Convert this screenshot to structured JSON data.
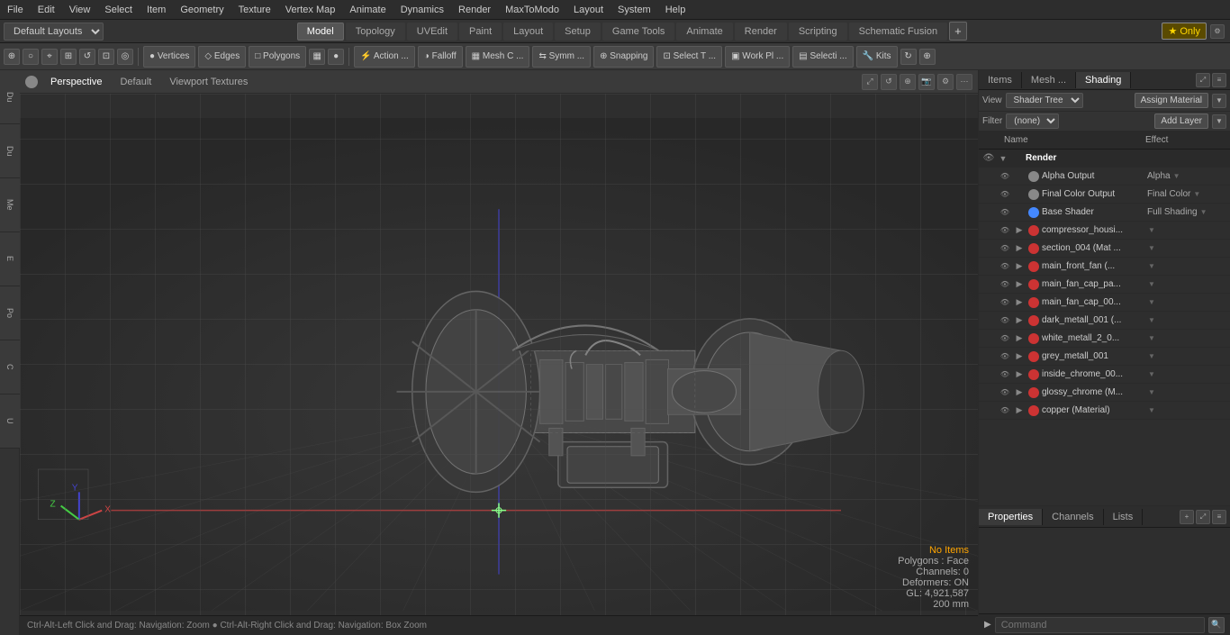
{
  "menubar": {
    "items": [
      "File",
      "Edit",
      "View",
      "Select",
      "Item",
      "Geometry",
      "Texture",
      "Vertex Map",
      "Animate",
      "Dynamics",
      "Render",
      "MaxToModo",
      "Layout",
      "System",
      "Help"
    ]
  },
  "layout_bar": {
    "dropdown": "Default Layouts",
    "tabs": [
      "Model",
      "Topology",
      "UVEdit",
      "Paint",
      "Layout",
      "Setup",
      "Game Tools",
      "Animate",
      "Render",
      "Scripting",
      "Schematic Fusion"
    ],
    "active_tab": "Model",
    "star_label": "★ Only",
    "plus_label": "+"
  },
  "toolbar": {
    "buttons": [
      {
        "label": "Vertices",
        "icon": "●"
      },
      {
        "label": "Edges",
        "icon": "◇"
      },
      {
        "label": "Polygons",
        "icon": "□"
      },
      {
        "label": "Action ...",
        "icon": "⚡"
      },
      {
        "label": "Falloff",
        "icon": "◑"
      },
      {
        "label": "Mesh C ...",
        "icon": "▦"
      },
      {
        "label": "Symm ...",
        "icon": "⇆"
      },
      {
        "label": "Snapping",
        "icon": "⊕"
      },
      {
        "label": "Select T ...",
        "icon": "⊡"
      },
      {
        "label": "Work Pl ...",
        "icon": "▣"
      },
      {
        "label": "Selecti ...",
        "icon": "▤"
      },
      {
        "label": "Kits",
        "icon": "🔧"
      }
    ]
  },
  "left_sidebar": {
    "tabs": [
      "Du",
      "Du",
      "Me",
      "E",
      "Po",
      "C",
      "U"
    ]
  },
  "viewport": {
    "header": {
      "dot_label": "●",
      "perspective": "Perspective",
      "default": "Default",
      "viewport_textures": "Viewport Textures"
    },
    "info": {
      "no_items": "No Items",
      "polygons": "Polygons : Face",
      "channels": "Channels: 0",
      "deformers": "Deformers: ON",
      "gl": "GL: 4,921,587",
      "size": "200 mm"
    },
    "status_bar": "Ctrl-Alt-Left Click and Drag: Navigation: Zoom  ●  Ctrl-Alt-Right Click and Drag: Navigation: Box Zoom"
  },
  "right_panel": {
    "top_tabs": [
      "Items",
      "Mesh ...",
      "Shading"
    ],
    "active_top_tab": "Shading",
    "view_label": "View",
    "view_options": [
      "Shader Tree"
    ],
    "assign_material": "Assign Material",
    "filter_label": "Filter",
    "filter_options": [
      "(none)"
    ],
    "add_layer": "Add Layer",
    "columns": {
      "name": "Name",
      "effect": "Effect"
    },
    "shader_items": [
      {
        "type": "render",
        "name": "Render",
        "effect": "",
        "indent": 0,
        "has_expand": true,
        "color": null
      },
      {
        "type": "item",
        "name": "Alpha Output",
        "effect": "Alpha",
        "indent": 1,
        "has_expand": false,
        "color": "#888"
      },
      {
        "type": "item",
        "name": "Final Color Output",
        "effect": "Final Color",
        "indent": 1,
        "has_expand": false,
        "color": "#888"
      },
      {
        "type": "item",
        "name": "Base Shader",
        "effect": "Full Shading",
        "indent": 1,
        "has_expand": false,
        "color": "#4488ff"
      },
      {
        "type": "item",
        "name": "compressor_housi...",
        "effect": "",
        "indent": 1,
        "has_expand": true,
        "color": "#cc3333"
      },
      {
        "type": "item",
        "name": "section_004 (Mat ...",
        "effect": "",
        "indent": 1,
        "has_expand": true,
        "color": "#cc3333"
      },
      {
        "type": "item",
        "name": "main_front_fan (...",
        "effect": "",
        "indent": 1,
        "has_expand": true,
        "color": "#cc3333"
      },
      {
        "type": "item",
        "name": "main_fan_cap_pa...",
        "effect": "",
        "indent": 1,
        "has_expand": true,
        "color": "#cc3333"
      },
      {
        "type": "item",
        "name": "main_fan_cap_00...",
        "effect": "",
        "indent": 1,
        "has_expand": true,
        "color": "#cc3333"
      },
      {
        "type": "item",
        "name": "dark_metall_001 (...",
        "effect": "",
        "indent": 1,
        "has_expand": true,
        "color": "#cc3333"
      },
      {
        "type": "item",
        "name": "white_metall_2_0...",
        "effect": "",
        "indent": 1,
        "has_expand": true,
        "color": "#cc3333"
      },
      {
        "type": "item",
        "name": "grey_metall_001",
        "effect": "",
        "indent": 1,
        "has_expand": true,
        "color": "#cc3333"
      },
      {
        "type": "item",
        "name": "inside_chrome_00...",
        "effect": "",
        "indent": 1,
        "has_expand": true,
        "color": "#cc3333"
      },
      {
        "type": "item",
        "name": "glossy_chrome (M...",
        "effect": "",
        "indent": 1,
        "has_expand": true,
        "color": "#cc3333"
      },
      {
        "type": "item",
        "name": "copper (Material)",
        "effect": "",
        "indent": 1,
        "has_expand": true,
        "color": "#cc3333"
      }
    ],
    "bottom_tabs": [
      "Properties",
      "Channels",
      "Lists"
    ],
    "active_bottom_tab": "Properties",
    "command_placeholder": "Command"
  }
}
